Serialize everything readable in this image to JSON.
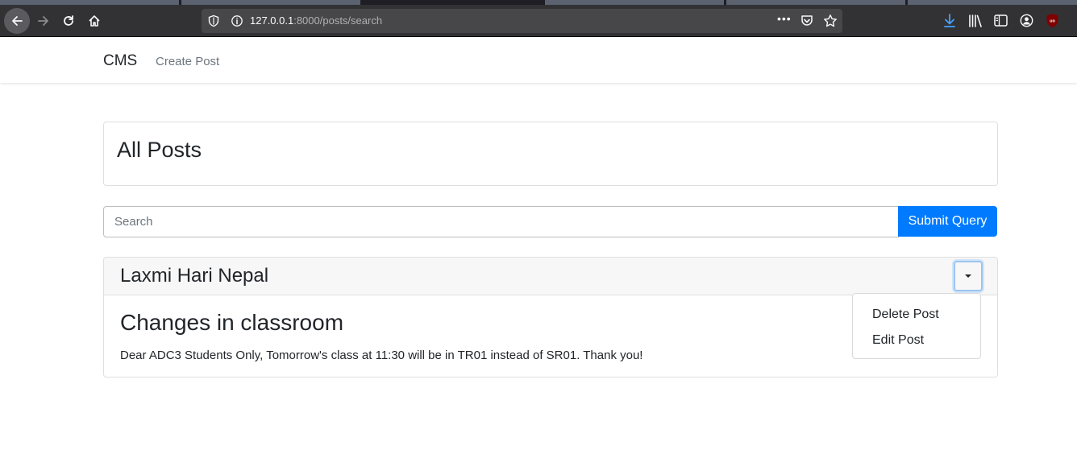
{
  "browser": {
    "url_host": "127.0.0.1",
    "url_rest": ":8000/posts/search",
    "more_glyph": "•••",
    "icons": [
      "back-icon",
      "forward-icon",
      "reload-icon",
      "home-icon",
      "shield-icon",
      "info-icon",
      "pocket-icon",
      "bookmark-star-icon",
      "download-icon",
      "library-icon",
      "sidebar-icon",
      "account-icon",
      "ublock-icon"
    ]
  },
  "navbar": {
    "brand": "CMS",
    "links": [
      "Create Post"
    ]
  },
  "header": {
    "title": "All Posts"
  },
  "search": {
    "placeholder": "Search",
    "value": "",
    "submit_label": "Submit Query"
  },
  "posts": [
    {
      "author": "Laxmi Hari Nepal",
      "title": "Changes in classroom",
      "body": "Dear ADC3 Students Only, Tomorrow's class at 11:30 will be in TR01 instead of SR01. Thank you!",
      "menu": [
        "Delete Post",
        "Edit Post"
      ]
    }
  ],
  "colors": {
    "primary": "#007bff",
    "toolbar": "#323234",
    "card_header": "#f7f7f7",
    "text": "#212529",
    "muted": "#6c757d"
  }
}
